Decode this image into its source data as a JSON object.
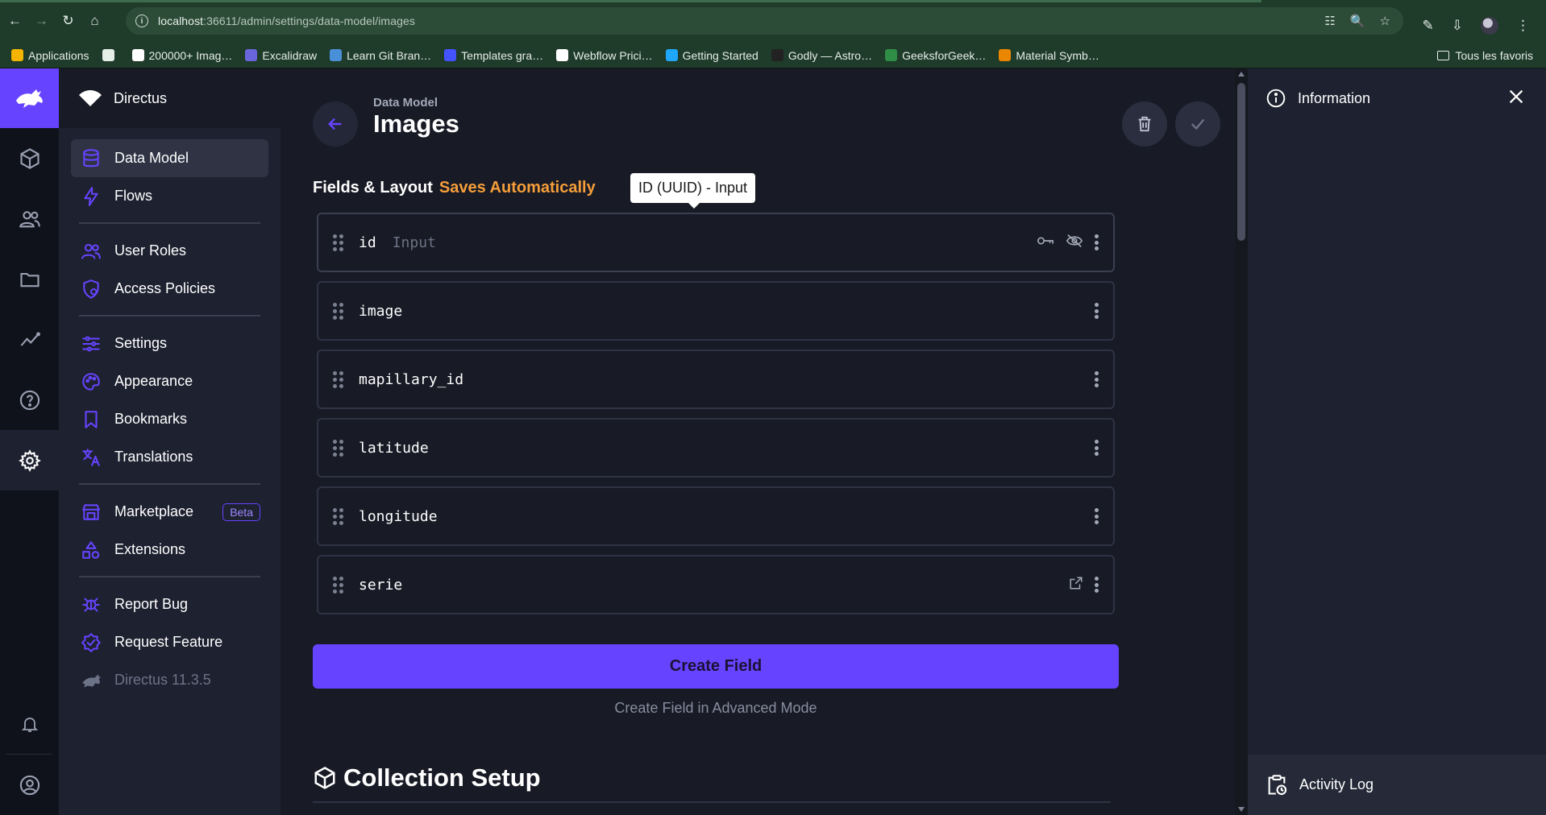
{
  "browser": {
    "url_host": "localhost",
    "url_rest": ":36611/admin/settings/data-model/images",
    "bookmarks": [
      {
        "label": "Applications",
        "color": "#f4b400"
      },
      {
        "label": "",
        "color": "#e6eee8"
      },
      {
        "label": "200000+ Imag…",
        "color": "#ffffff"
      },
      {
        "label": "Excalidraw",
        "color": "#6965db"
      },
      {
        "label": "Learn Git Bran…",
        "color": "#4a90d9"
      },
      {
        "label": "Templates gra…",
        "color": "#4353ff"
      },
      {
        "label": "Webflow Prici…",
        "color": "#ffffff"
      },
      {
        "label": "Getting Started",
        "color": "#1ea7fd"
      },
      {
        "label": "Godly — Astro…",
        "color": "#222222"
      },
      {
        "label": "GeeksforGeek…",
        "color": "#2f8d46"
      },
      {
        "label": "Material Symb…",
        "color": "#ea8600"
      }
    ],
    "all_bookmarks": "Tous les favoris"
  },
  "app": {
    "project_name": "Directus",
    "accent": "#6644ff",
    "nav": [
      {
        "label": "Data Model",
        "icon": "database-icon",
        "active": true
      },
      {
        "label": "Flows",
        "icon": "bolt-icon"
      },
      {
        "label": "User Roles",
        "icon": "group-icon"
      },
      {
        "label": "Access Policies",
        "icon": "policy-icon"
      },
      {
        "label": "Settings",
        "icon": "sliders-icon"
      },
      {
        "label": "Appearance",
        "icon": "palette-icon"
      },
      {
        "label": "Bookmarks",
        "icon": "bookmark-icon"
      },
      {
        "label": "Translations",
        "icon": "translate-icon"
      },
      {
        "label": "Marketplace",
        "icon": "storefront-icon",
        "badge": "Beta"
      },
      {
        "label": "Extensions",
        "icon": "shapes-icon"
      },
      {
        "label": "Report Bug",
        "icon": "bug-icon"
      },
      {
        "label": "Request Feature",
        "icon": "verified-icon"
      },
      {
        "label": "Directus 11.3.5",
        "icon": "directus-rabbit-icon"
      }
    ]
  },
  "header": {
    "breadcrumb": "Data Model",
    "title": "Images"
  },
  "fields_section": {
    "label": "Fields & Layout",
    "status": "Saves Automatically",
    "tooltip": "ID (UUID) - Input",
    "fields": [
      {
        "name": "id",
        "interface": "Input"
      },
      {
        "name": "image",
        "interface": ""
      },
      {
        "name": "mapillary_id",
        "interface": ""
      },
      {
        "name": "latitude",
        "interface": ""
      },
      {
        "name": "longitude",
        "interface": ""
      },
      {
        "name": "serie",
        "interface": ""
      }
    ],
    "create_field": "Create Field",
    "create_advanced": "Create Field in Advanced Mode"
  },
  "collection_setup": {
    "title": "Collection Setup"
  },
  "sidebar": {
    "info_label": "Information",
    "activity_label": "Activity Log"
  }
}
